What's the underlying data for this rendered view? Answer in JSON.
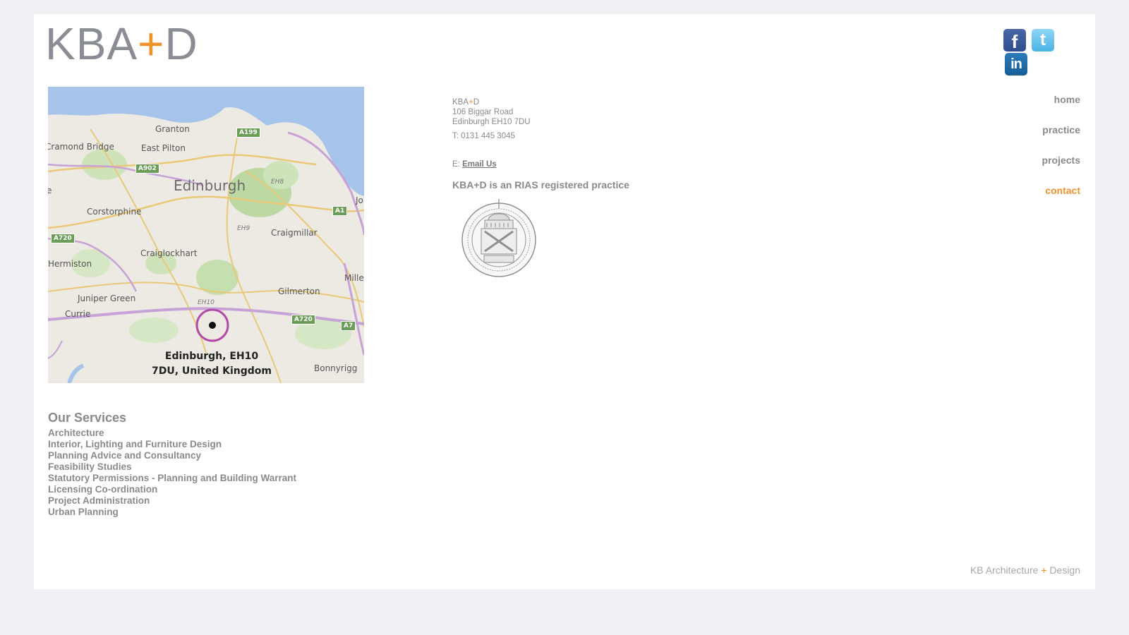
{
  "logo": {
    "part1": "KBA",
    "plus": "+",
    "part2": "D"
  },
  "social": {
    "facebook": "f",
    "twitter": "t",
    "linkedin": "in"
  },
  "map": {
    "labels": {
      "granton": "Granton",
      "cramond": "Cramond Bridge",
      "east_pilton": "East Pilton",
      "edinburgh": "Edinburgh",
      "eh8": "EH8",
      "joppa": "Jo",
      "corstorphine": "Corstorphine",
      "eh9": "EH9",
      "craigmillar": "Craigmillar",
      "craiglockhart": "Craiglockhart",
      "hermiston": "Hermiston",
      "mille": "Mille",
      "juniper_green": "Juniper Green",
      "gilmerton": "Gilmerton",
      "currie": "Currie",
      "eh10": "EH10",
      "bonnyrigg": "Bonnyrigg",
      "edge_e": "e"
    },
    "roads": {
      "a199": "A199",
      "a902": "A902",
      "a1": "A1",
      "a720_w": "A720",
      "a720_e": "A720",
      "a7": "A7"
    },
    "pin_line1": "Edinburgh, EH10",
    "pin_line2": "7DU, United Kingdom"
  },
  "services": {
    "heading": "Our Services",
    "items": [
      "Architecture",
      "Interior, Lighting and Furniture Design",
      "Planning Advice and Consultancy",
      "Feasibility Studies",
      "Statutory Permissions - Planning and Building Warrant",
      "Licensing Co-ordination",
      "Project Administration",
      "Urban Planning"
    ]
  },
  "contact": {
    "name_part1": "KBA",
    "name_plus": "+",
    "name_part2": "D",
    "address1": "106 Biggar Road",
    "address2": "Edinburgh EH10 7DU",
    "phone": "T: 0131 445 3045",
    "email_prefix": "E: ",
    "email_link": "Email Us",
    "rias": "KBA+D is an RIAS registered practice"
  },
  "nav": {
    "home": "home",
    "practice": "practice",
    "projects": "projects",
    "contact": "contact"
  },
  "footer": {
    "part1": "KB Architecture ",
    "plus": "+",
    "part2": " Design"
  },
  "colors": {
    "accent": "#f0922b",
    "text": "#8a8a8a",
    "background": "#f0f1f4"
  }
}
